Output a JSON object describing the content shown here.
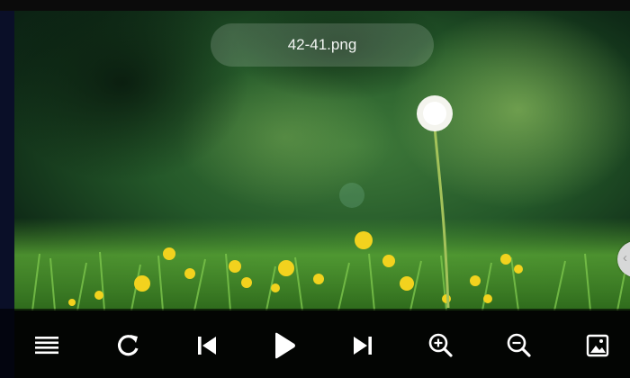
{
  "viewer": {
    "filename": "42-41.png"
  },
  "toolbar": {
    "buttons": [
      {
        "icon": "menu-icon"
      },
      {
        "icon": "refresh-icon"
      },
      {
        "icon": "skip-previous-icon"
      },
      {
        "icon": "play-icon"
      },
      {
        "icon": "skip-next-icon"
      },
      {
        "icon": "zoom-in-icon"
      },
      {
        "icon": "zoom-out-icon"
      },
      {
        "icon": "image-icon"
      }
    ]
  },
  "side_handle": {
    "icon": "chevron-left-icon"
  },
  "colors": {
    "toolbar_bg": "#000000",
    "icon": "#ffffff",
    "pill_bg": "#ffffff29"
  }
}
